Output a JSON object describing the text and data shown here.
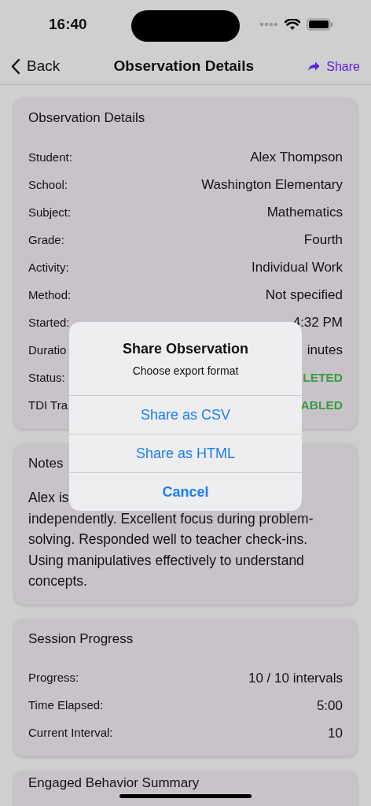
{
  "status_bar": {
    "time": "16:40"
  },
  "nav": {
    "back": "Back",
    "title": "Observation Details",
    "share": "Share"
  },
  "cards": [
    {
      "title": "Observation Details",
      "kind": "fields",
      "rows": [
        {
          "label": "Student:",
          "value": "Alex Thompson",
          "kind": "plain"
        },
        {
          "label": "School:",
          "value": "Washington Elementary",
          "kind": "plain"
        },
        {
          "label": "Subject:",
          "value": "Mathematics",
          "kind": "plain"
        },
        {
          "label": "Grade:",
          "value": "Fourth",
          "kind": "plain"
        },
        {
          "label": "Activity:",
          "value": "Individual Work",
          "kind": "plain"
        },
        {
          "label": "Method:",
          "value": "Not specified",
          "kind": "plain"
        },
        {
          "label": "Started:",
          "value": "4:32 PM",
          "kind": "plain"
        },
        {
          "label": "Duratio",
          "value": "inutes",
          "kind": "plain"
        },
        {
          "label": "Status:",
          "value": "LETED",
          "kind": "status"
        },
        {
          "label": "TDI Tra",
          "value": "ABLED",
          "kind": "status"
        }
      ]
    },
    {
      "title": "Notes",
      "kind": "text",
      "first_line": "Alex is",
      "text": "independently. Excellent focus during problem-solving. Responded well to teacher check-ins. Using manipulatives effectively to understand concepts."
    },
    {
      "title": "Session Progress",
      "kind": "fields",
      "rows": [
        {
          "label": "Progress:",
          "value": "10 / 10 intervals",
          "kind": "plain"
        },
        {
          "label": "Time Elapsed:",
          "value": "5:00",
          "kind": "plain"
        },
        {
          "label": "Current Interval:",
          "value": "10",
          "kind": "plain"
        }
      ]
    },
    {
      "title": "Engaged Behavior Summary",
      "kind": "cut"
    }
  ],
  "alert": {
    "title": "Share Observation",
    "message": "Choose export format",
    "actions": [
      {
        "label": "Share as CSV",
        "kind": "default"
      },
      {
        "label": "Share as HTML",
        "kind": "default"
      },
      {
        "label": "Cancel",
        "kind": "cancel"
      }
    ]
  }
}
